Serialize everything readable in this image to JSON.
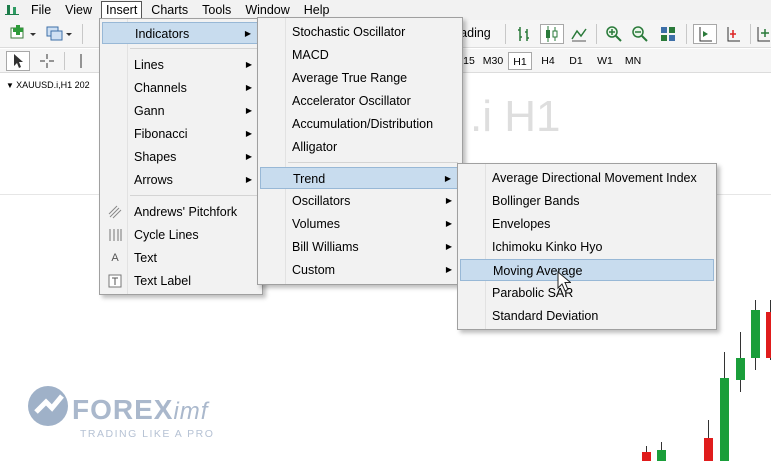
{
  "menubar": {
    "items": [
      {
        "label": "File"
      },
      {
        "label": "View"
      },
      {
        "label": "Insert"
      },
      {
        "label": "Charts"
      },
      {
        "label": "Tools"
      },
      {
        "label": "Window"
      },
      {
        "label": "Help"
      }
    ]
  },
  "toolbar": {
    "trading_label": "rading"
  },
  "timeframes": [
    "15",
    "M30",
    "H1",
    "H4",
    "D1",
    "W1",
    "MN"
  ],
  "chart": {
    "header": "XAUUSD.i,H1  202",
    "watermark": ".i H1"
  },
  "insert_menu": {
    "items": [
      {
        "label": "Indicators",
        "submenu": true
      },
      {
        "label": "Lines",
        "submenu": true
      },
      {
        "label": "Channels",
        "submenu": true
      },
      {
        "label": "Gann",
        "submenu": true
      },
      {
        "label": "Fibonacci",
        "submenu": true
      },
      {
        "label": "Shapes",
        "submenu": true
      },
      {
        "label": "Arrows",
        "submenu": true
      },
      {
        "label": "Andrews' Pitchfork",
        "icon": "pitchfork-icon"
      },
      {
        "label": "Cycle Lines",
        "icon": "cycle-lines-icon"
      },
      {
        "label": "Text",
        "icon": "text-icon"
      },
      {
        "label": "Text Label",
        "icon": "text-label-icon"
      }
    ]
  },
  "indicators_menu": {
    "items": [
      {
        "label": "Stochastic Oscillator"
      },
      {
        "label": "MACD"
      },
      {
        "label": "Average True Range"
      },
      {
        "label": "Accelerator Oscillator"
      },
      {
        "label": "Accumulation/Distribution"
      },
      {
        "label": "Alligator"
      },
      {
        "label": "Trend",
        "submenu": true
      },
      {
        "label": "Oscillators",
        "submenu": true
      },
      {
        "label": "Volumes",
        "submenu": true
      },
      {
        "label": "Bill Williams",
        "submenu": true
      },
      {
        "label": "Custom",
        "submenu": true
      }
    ]
  },
  "trend_menu": {
    "items": [
      {
        "label": "Average Directional Movement Index"
      },
      {
        "label": "Bollinger Bands"
      },
      {
        "label": "Envelopes"
      },
      {
        "label": "Ichimoku Kinko Hyo"
      },
      {
        "label": "Moving Average"
      },
      {
        "label": "Parabolic SAR"
      },
      {
        "label": "Standard Deviation"
      }
    ]
  },
  "logo": {
    "brand": "FOREX",
    "brand_suffix": "imf",
    "tagline": "TRADING LIKE A PRO"
  },
  "colors": {
    "highlight": "#c8dcee",
    "bull_candle": "#1a9e3a",
    "bear_candle": "#e01c1c",
    "logo": "#9fb1c8"
  }
}
